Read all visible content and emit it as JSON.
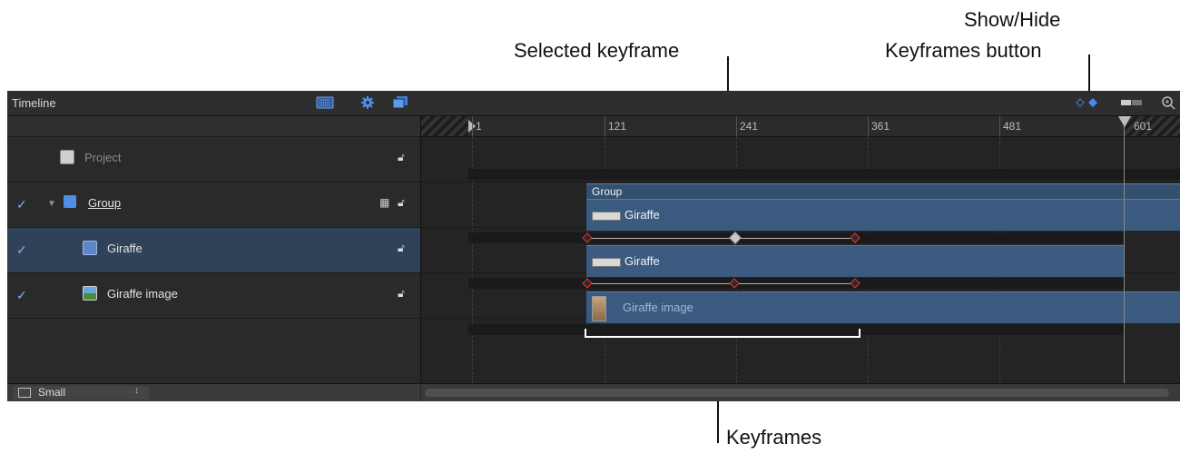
{
  "callouts": {
    "selected_keyframe": "Selected keyframe",
    "show_hide_line1": "Show/Hide",
    "show_hide_line2": "Keyframes button",
    "keyframes": "Keyframes"
  },
  "timeline": {
    "title": "Timeline",
    "header_icons": [
      "grid-icon",
      "gear-icon",
      "layers-icon",
      "keyframes-toggle-icon",
      "toggle-icon",
      "zoom-icon"
    ],
    "ruler_ticks": [
      "1",
      "121",
      "241",
      "361",
      "481",
      "601"
    ],
    "layers": [
      {
        "name": "Project",
        "icon": "project-icon",
        "checked": false,
        "expanded": false
      },
      {
        "name": "Group",
        "icon": "group-icon",
        "checked": true,
        "expanded": true
      },
      {
        "name": "Giraffe",
        "icon": "text-layer-icon",
        "checked": true,
        "selected": true
      },
      {
        "name": "Giraffe image",
        "icon": "image-icon",
        "checked": true
      }
    ],
    "tracks": {
      "group_label": "Group",
      "giraffe_label": "Giraffe",
      "image_label": "Giraffe image"
    },
    "footer": {
      "size_label": "Small"
    },
    "accent_color": "#3b5a80",
    "keyframe_color": "#ee3333"
  }
}
